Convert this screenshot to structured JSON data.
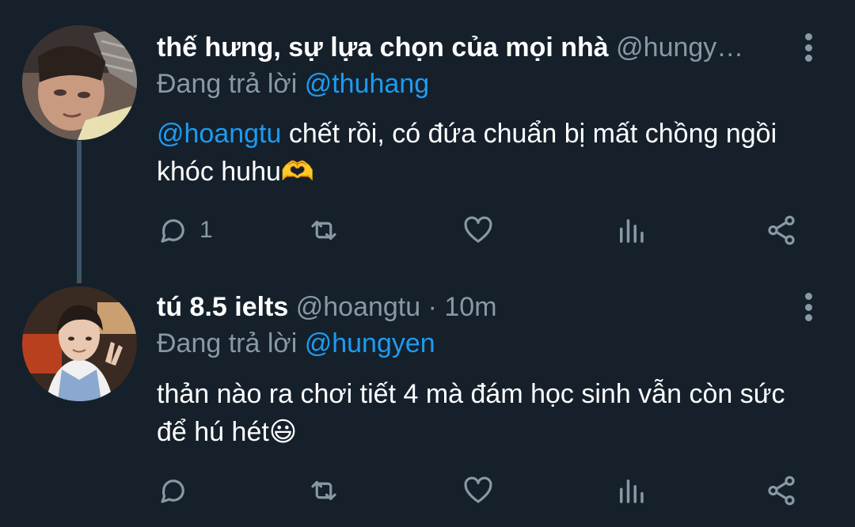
{
  "tweets": [
    {
      "name": "thế hưng, sự lựa chọn của mọi nhà",
      "handle": "@hungy…",
      "dot": "",
      "time": "",
      "reply_prefix": "Đang trả lời",
      "reply_to": "@thuhang",
      "mention": "@hoangtu",
      "text": " chết rồi, có đứa chuẩn bị mất chồng ngồi khóc huhu🫶",
      "reply_count": "1"
    },
    {
      "name": "tú 8.5 ielts",
      "handle": "@hoangtu",
      "dot": " · ",
      "time": "10m",
      "reply_prefix": "Đang trả lời",
      "reply_to": "@hungyen",
      "mention": "",
      "text": "thản nào ra chơi tiết 4 mà đám học sinh vẫn còn sức để hú hét😃",
      "reply_count": ""
    }
  ],
  "icons": [
    "reply-icon",
    "retweet-icon",
    "like-icon",
    "stats-icon",
    "share-icon",
    "more-icon"
  ],
  "colors": {
    "background": "#15202b",
    "accent": "#1d9bf0",
    "muted": "#8899a6",
    "thread": "#3d5466"
  }
}
